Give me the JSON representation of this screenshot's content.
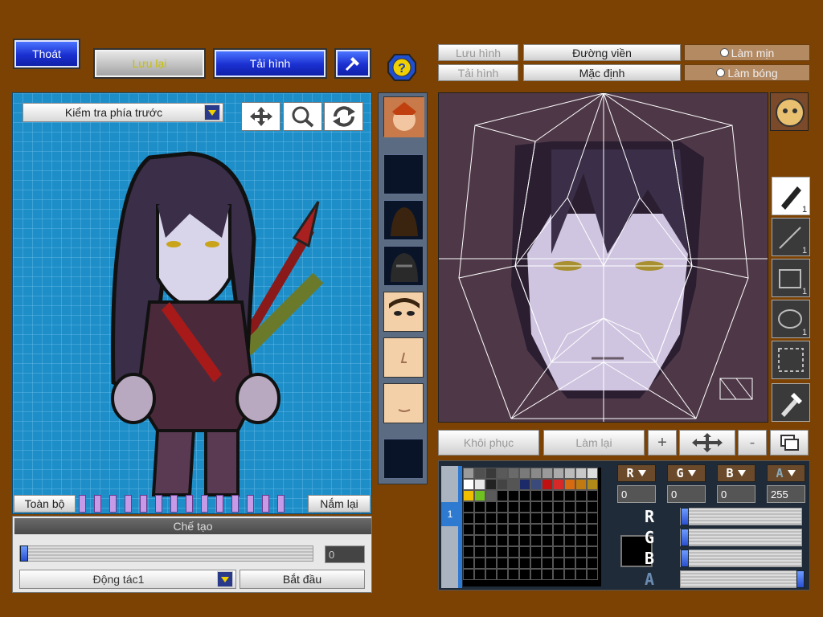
{
  "top_buttons": {
    "exit": "Thoát",
    "save": "Lưu lại",
    "load": "Tải hình"
  },
  "left_panel": {
    "view_select": "Kiểm tra phía trước",
    "all_label": "Toàn bộ",
    "grab_label": "Nắm lại",
    "create_title": "Chế tạo",
    "create_value": "0",
    "action_select": "Động tác1",
    "start_button": "Bắt đầu"
  },
  "editor": {
    "save_image": "Lưu hình",
    "load_image": "Tải hình",
    "outline": "Đường viền",
    "default": "Mặc định",
    "smooth": "Làm mịn",
    "shade": "Làm bóng",
    "restore": "Khôi phục",
    "redo": "Làm lại"
  },
  "color": {
    "channels": [
      "R",
      "G",
      "B",
      "A"
    ],
    "values": [
      "0",
      "0",
      "0",
      "255"
    ],
    "slider_labels": [
      "R",
      "G",
      "B",
      "A"
    ],
    "current": "#000000",
    "palette": [
      "#9a9a9a",
      "#505050",
      "#3a3a3a",
      "#5a5a5a",
      "#6a6a6a",
      "#7a7a7a",
      "#8a8a8a",
      "#9a9a9a",
      "#aaaaaa",
      "#bbbbbb",
      "#c8c8c8",
      "#dddddd",
      "#ffffff",
      "#e8e8e8",
      "#222222",
      "#444444",
      "#555555",
      "#1c2a6a",
      "#3a4a7a",
      "#c01010",
      "#d82828",
      "#d86a10",
      "#c07a10",
      "#b08a18",
      "#f0c000",
      "#70c020",
      "#5a5a5a"
    ]
  },
  "tools": [
    "pen-tool",
    "line-tool",
    "rect-tool",
    "ellipse-tool",
    "select-tool",
    "eyedropper-tool"
  ],
  "tool_sizes": [
    "1",
    "1",
    "1",
    "1"
  ]
}
